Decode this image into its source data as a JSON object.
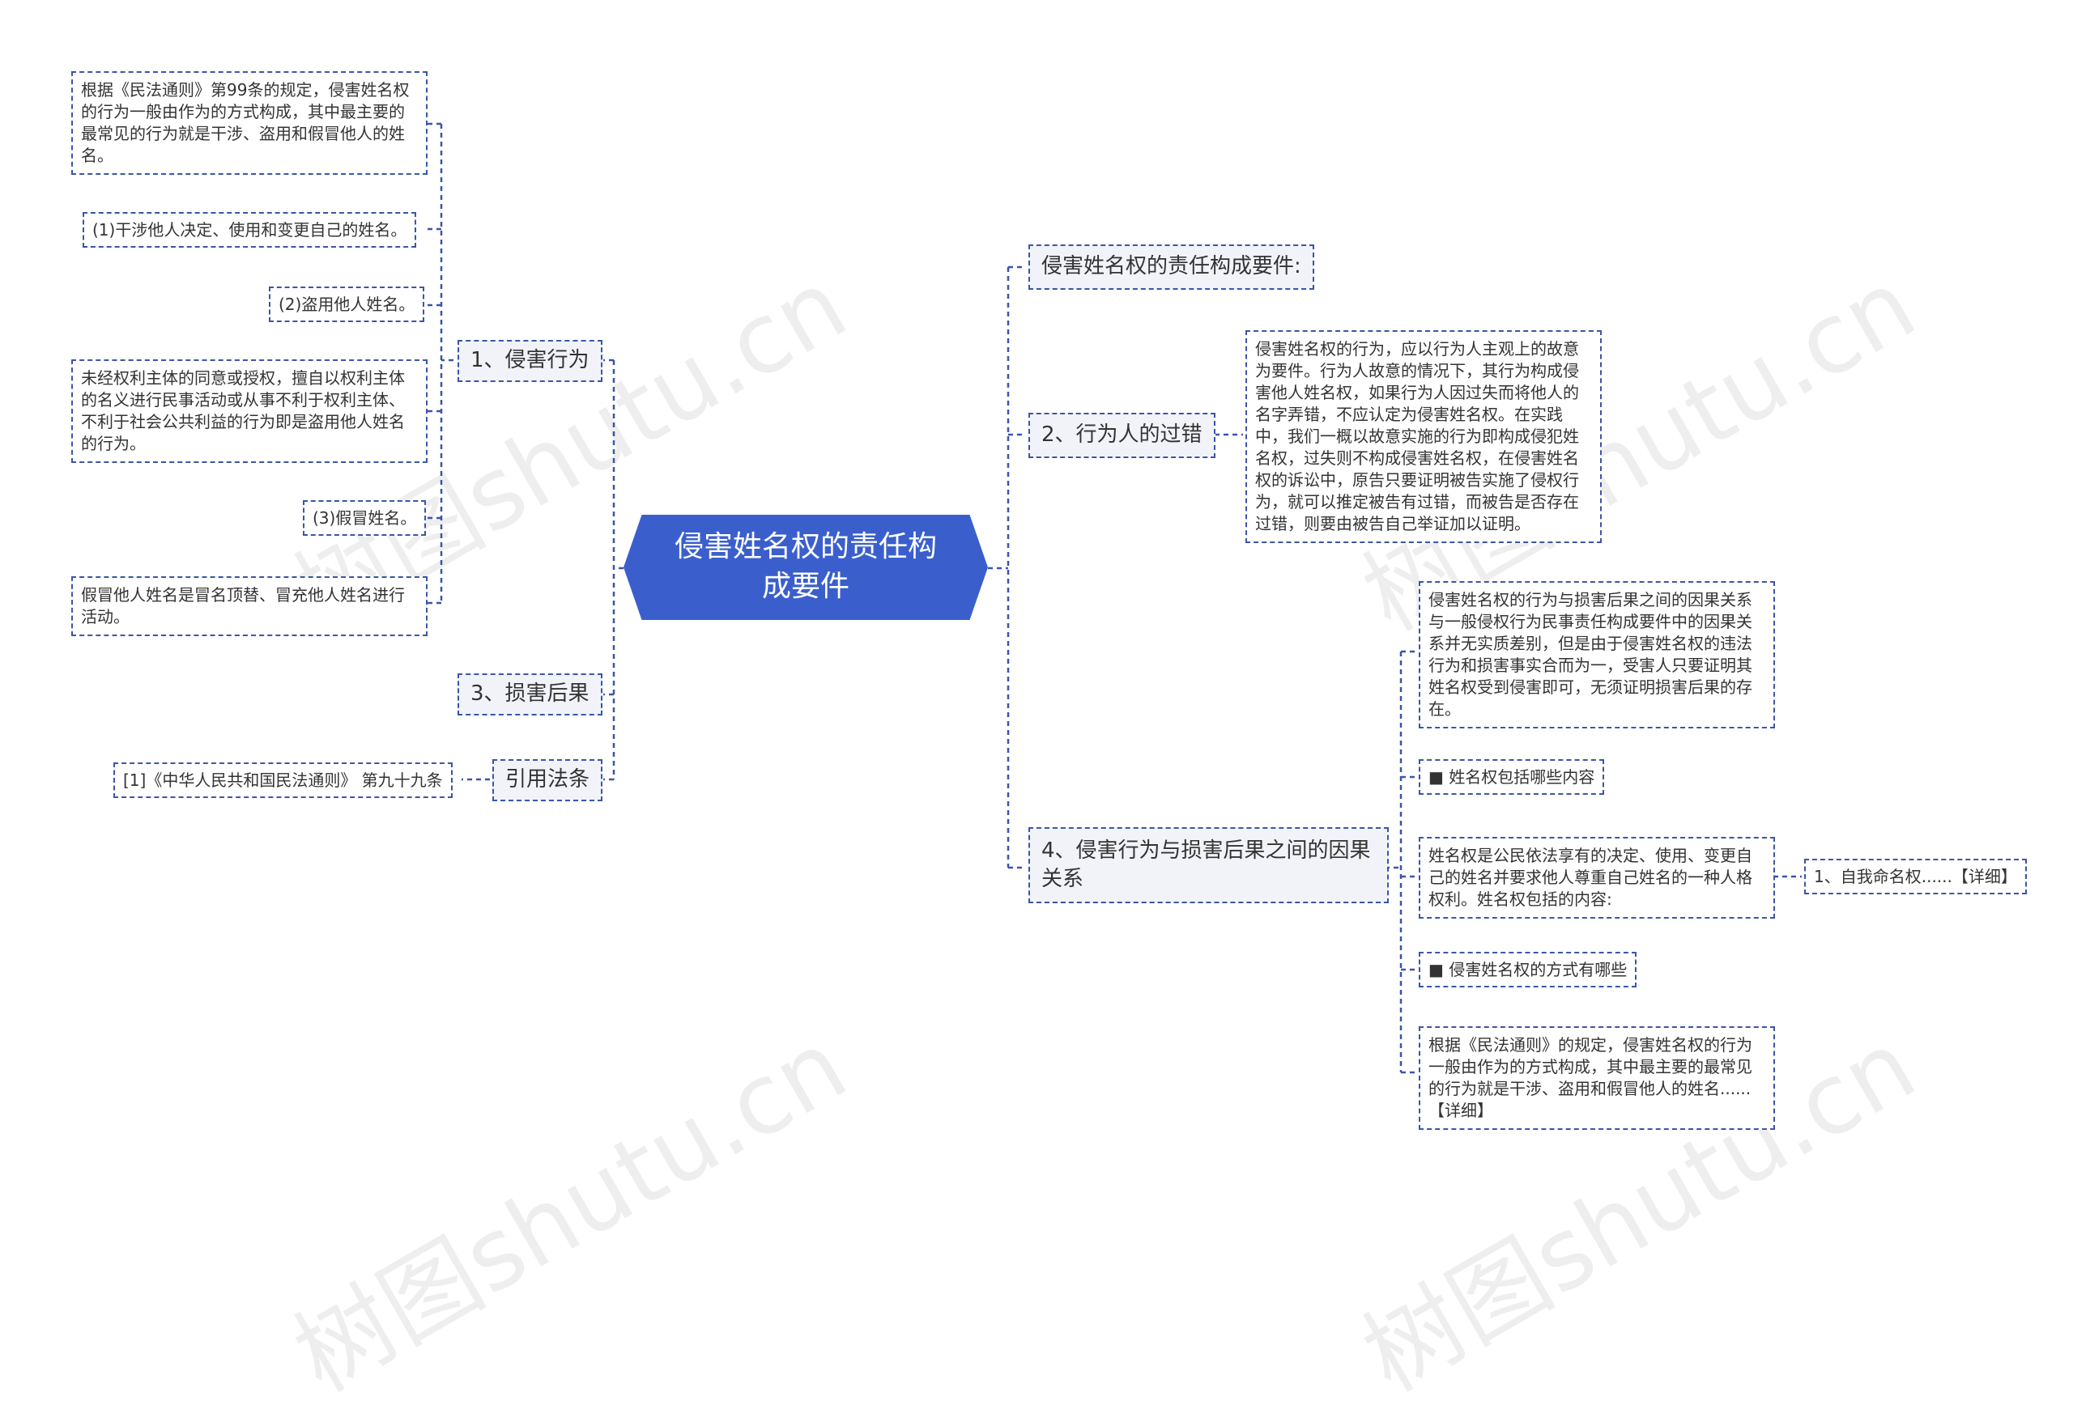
{
  "center": {
    "title": "侵害姓名权的责任构成要件"
  },
  "left": {
    "branches": [
      {
        "label": "1、侵害行为",
        "children": [
          "根据《民法通则》第99条的规定，侵害姓名权的行为一般由作为的方式构成，其中最主要的最常见的行为就是干涉、盗用和假冒他人的姓名。",
          "(1)干涉他人决定、使用和变更自己的姓名。",
          "(2)盗用他人姓名。",
          "未经权利主体的同意或授权，擅自以权利主体的名义进行民事活动或从事不利于权利主体、不利于社会公共利益的行为即是盗用他人姓名的行为。",
          "(3)假冒姓名。",
          "假冒他人姓名是冒名顶替、冒充他人姓名进行活动。"
        ]
      },
      {
        "label": "3、损害后果"
      },
      {
        "label": "引用法条",
        "children": [
          "[1]《中华人民共和国民法通则》 第九十九条"
        ]
      }
    ]
  },
  "right": {
    "branches": [
      {
        "label": "侵害姓名权的责任构成要件:"
      },
      {
        "label": "2、行为人的过错",
        "children": [
          "侵害姓名权的行为，应以行为人主观上的故意为要件。行为人故意的情况下，其行为构成侵害他人姓名权，如果行为人因过失而将他人的名字弄错，不应认定为侵害姓名权。在实践中，我们一概以故意实施的行为即构成侵犯姓名权，过失则不构成侵害姓名权，在侵害姓名权的诉讼中，原告只要证明被告实施了侵权行为，就可以推定被告有过错，而被告是否存在过错，则要由被告自己举证加以证明。"
        ]
      },
      {
        "label": "4、侵害行为与损害后果之间的因果关系",
        "children": [
          "侵害姓名权的行为与损害后果之间的因果关系与一般侵权行为民事责任构成要件中的因果关系并无实质差别，但是由于侵害姓名权的违法行为和损害事实合而为一，受害人只要证明其姓名权受到侵害即可，无须证明损害后果的存在。",
          "■ 姓名权包括哪些内容",
          "姓名权是公民依法享有的决定、使用、变更自己的姓名并要求他人尊重自己姓名的一种人格权利。姓名权包括的内容:",
          "■ 侵害姓名权的方式有哪些",
          "根据《民法通则》的规定，侵害姓名权的行为一般由作为的方式构成，其中最主要的最常见的行为就是干涉、盗用和假冒他人的姓名......【详细】"
        ],
        "sub_child": "1、自我命名权......【详细】"
      }
    ]
  },
  "watermark": "树图shutu.cn",
  "colors": {
    "center_fill": "#3a5fcd",
    "border": "#3b55a8",
    "branch_fill": "#f1f3f9"
  }
}
